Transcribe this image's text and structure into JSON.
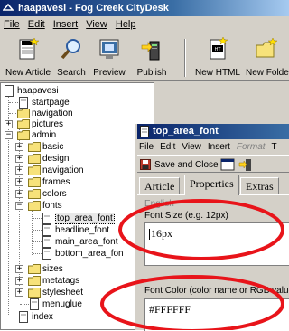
{
  "window": {
    "title": "haapavesi - Fog Creek CityDesk"
  },
  "menubar": {
    "items": [
      "File",
      "Edit",
      "Insert",
      "View",
      "Help"
    ]
  },
  "toolbar": {
    "new_article": "New Article",
    "search": "Search",
    "preview": "Preview",
    "publish": "Publish",
    "new_html": "New HTML",
    "new_folder": "New Folde"
  },
  "tree": {
    "root": "haapavesi",
    "startpage": "startpage",
    "navigation": "navigation",
    "pictures": "pictures",
    "admin": "admin",
    "basic": "basic",
    "design": "design",
    "admin_navigation": "navigation",
    "frames": "frames",
    "colors": "colors",
    "fonts": "fonts",
    "top_area_font": "top_area_font",
    "headline_font": "headline_font",
    "main_area_font": "main_area_font",
    "bottom_area_font": "bottom_area_fon",
    "sizes": "sizes",
    "metatags": "metatags",
    "stylesheet": "stylesheet",
    "menuglue": "menuglue",
    "index": "index"
  },
  "editor": {
    "title": "top_area_font",
    "menu": {
      "file": "File",
      "edit": "Edit",
      "view": "View",
      "insert": "Insert",
      "format": "Format",
      "t": "T"
    },
    "save_and_close": "Save and Close",
    "tabs": {
      "article": "Article",
      "properties": "Properties",
      "extras": "Extras"
    },
    "language_label": "English",
    "font_size": {
      "label": "Font Size (e.g. 12px)",
      "value": "16px"
    },
    "font_color": {
      "label": "Font Color (color name or RGB value)",
      "value": "#FFFFFF"
    }
  },
  "colors": {
    "annotation": "#e8141a",
    "title_bar": "#0a246a",
    "folder": "#f7e27a"
  }
}
